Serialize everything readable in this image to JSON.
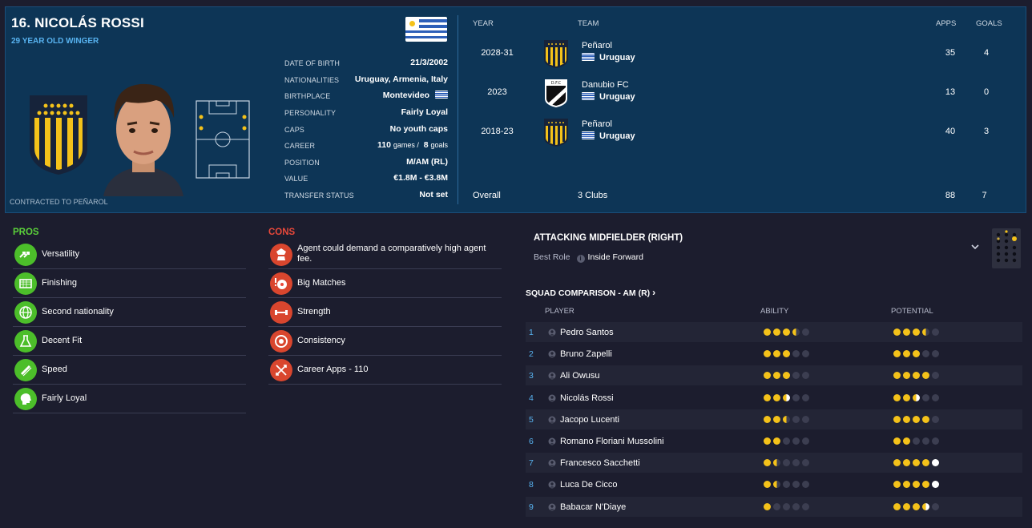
{
  "player": {
    "name": "16. NICOLÁS ROSSI",
    "subtitle": "29 YEAR OLD WINGER",
    "contracted": "CONTRACTED TO PEÑAROL"
  },
  "info": [
    {
      "label": "DATE OF BIRTH",
      "value": "21/3/2002"
    },
    {
      "label": "NATIONALITIES",
      "value": "Uruguay, Armenia, Italy"
    },
    {
      "label": "BIRTHPLACE",
      "value": "Montevideo"
    },
    {
      "label": "PERSONALITY",
      "value": "Fairly Loyal"
    },
    {
      "label": "CAPS",
      "value": "No youth caps"
    },
    {
      "label": "CAREER",
      "value": "110",
      "games_word": "games /",
      "goals": "8",
      "goals_word": "goals"
    },
    {
      "label": "POSITION",
      "value": "M/AM (RL)"
    },
    {
      "label": "VALUE",
      "value": "€1.8M - €3.8M"
    },
    {
      "label": "TRANSFER STATUS",
      "value": "Not set"
    }
  ],
  "history": {
    "headers": {
      "year": "YEAR",
      "team": "TEAM",
      "apps": "APPS",
      "goals": "GOALS"
    },
    "rows": [
      {
        "year": "2028-31",
        "team": "Peñarol",
        "nation": "Uruguay",
        "apps": "35",
        "goals": "4",
        "crest": "penarol-crest"
      },
      {
        "year": "2023",
        "team": "Danubio FC",
        "nation": "Uruguay",
        "apps": "13",
        "goals": "0",
        "crest": "danubio-crest"
      },
      {
        "year": "2018-23",
        "team": "Peñarol",
        "nation": "Uruguay",
        "apps": "40",
        "goals": "3",
        "crest": "penarol-crest"
      }
    ],
    "overall": {
      "label": "Overall",
      "clubs": "3 Clubs",
      "apps": "88",
      "goals": "7"
    }
  },
  "pros": {
    "title": "PROS",
    "items": [
      {
        "label": "Versatility",
        "icon": "arrows-icon"
      },
      {
        "label": "Finishing",
        "icon": "goal-net-icon"
      },
      {
        "label": "Second nationality",
        "icon": "globe-icon"
      },
      {
        "label": "Decent Fit",
        "icon": "flask-icon"
      },
      {
        "label": "Speed",
        "icon": "speed-icon"
      },
      {
        "label": "Fairly Loyal",
        "icon": "head-icon"
      }
    ]
  },
  "cons": {
    "title": "CONS",
    "items": [
      {
        "label": "Agent could demand a comparatively high agent fee.",
        "icon": "agent-icon"
      },
      {
        "label": "Big Matches",
        "icon": "ball-alert-icon"
      },
      {
        "label": "Strength",
        "icon": "dumbbell-icon"
      },
      {
        "label": "Consistency",
        "icon": "target-icon"
      },
      {
        "label": "Career Apps - 110",
        "icon": "crossed-arrows-icon"
      }
    ]
  },
  "role": {
    "title": "ATTACKING MIDFIELDER (RIGHT)",
    "best_role_label": "Best Role",
    "best_role": "Inside Forward",
    "info_glyph": "i"
  },
  "squad": {
    "title": "SQUAD COMPARISON - AM (R)",
    "chevron": "›",
    "headers": {
      "player": "PLAYER",
      "ability": "ABILITY",
      "potential": "POTENTIAL"
    },
    "rows": [
      {
        "n": "1",
        "name": "Pedro Santos",
        "ability": 3.5,
        "potential": 3.5
      },
      {
        "n": "2",
        "name": "Bruno Zapelli",
        "ability": 3,
        "potential": 3
      },
      {
        "n": "3",
        "name": "Ali Owusu",
        "ability": 3,
        "potential": 4
      },
      {
        "n": "4",
        "name": "Nicolás Rossi",
        "ability": 2.5,
        "potential": 2.5,
        "white_half": true
      },
      {
        "n": "5",
        "name": "Jacopo Lucenti",
        "ability": 2.5,
        "potential": 4
      },
      {
        "n": "6",
        "name": "Romano Floriani Mussolini",
        "ability": 2,
        "potential": 2
      },
      {
        "n": "7",
        "name": "Francesco Sacchetti",
        "ability": 1.5,
        "potential": 5,
        "potential_white_tail": 1
      },
      {
        "n": "8",
        "name": "Luca De Cicco",
        "ability": 1.5,
        "potential": 5,
        "potential_white_tail": 1
      },
      {
        "n": "9",
        "name": "Babacar N'Diaye",
        "ability": 1,
        "potential": 3.5,
        "potential_white_half": true
      }
    ]
  },
  "colors": {
    "accent": "#58b3f0",
    "pros": "#5bd13a",
    "cons": "#e8483a",
    "star": "#f4c21a",
    "panel": "#0d3556"
  }
}
